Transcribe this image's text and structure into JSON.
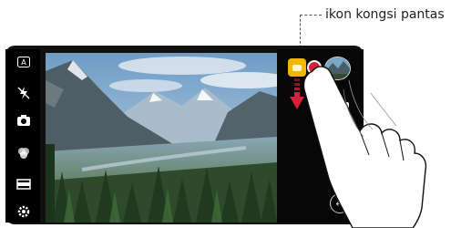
{
  "callout": {
    "label": "ikon kongsi pantas"
  },
  "colors": {
    "share_icon": "#f2b705",
    "record_dot": "#d61f3a",
    "panel_bg": "#070707"
  },
  "icons": {
    "left_bar": [
      "auto-mode-icon",
      "flash-off-icon",
      "switch-camera-icon",
      "filter-icon",
      "aspect-ratio-icon",
      "settings-icon"
    ],
    "right_panel": [
      "quick-share-icon",
      "gallery-thumbnail",
      "video-record-icon",
      "shutter-icon",
      "back-icon"
    ]
  }
}
